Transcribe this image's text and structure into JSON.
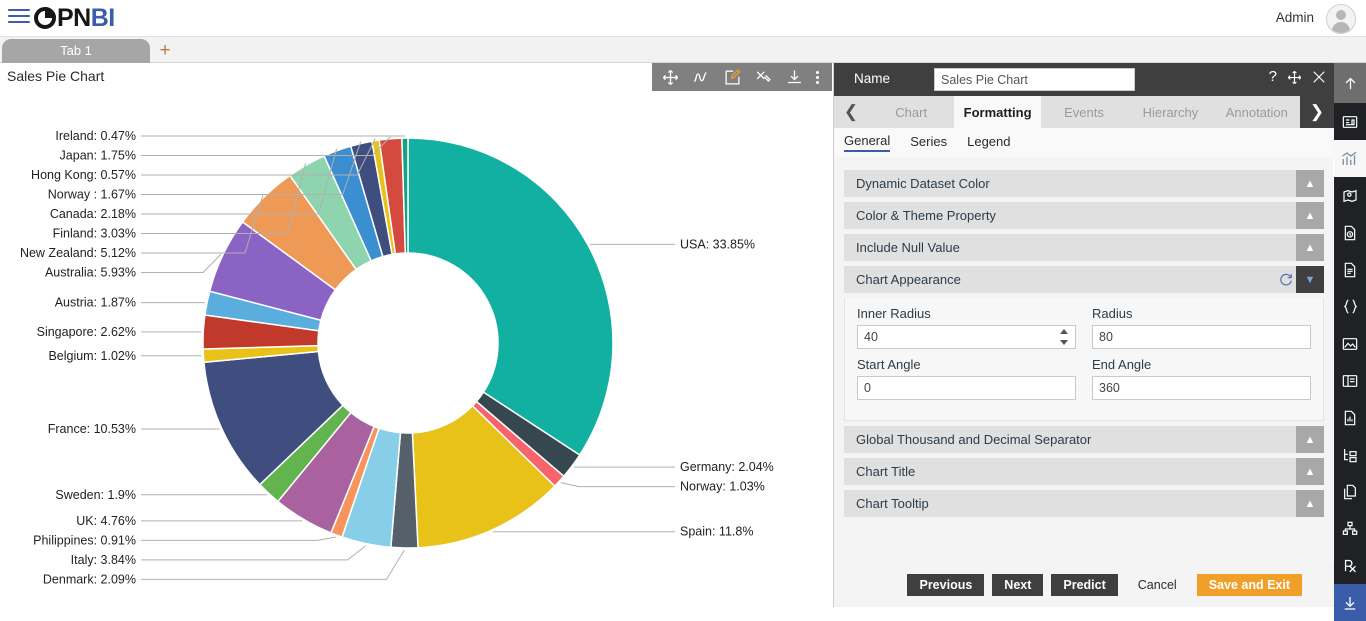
{
  "app": {
    "logo_dark": "PN",
    "logo_blue": "BI",
    "menu_icon": "hamburger-icon",
    "user_name": "Admin"
  },
  "tabstrip": {
    "tabs": [
      {
        "label": "Tab 1"
      }
    ],
    "add_label": "+",
    "icons": [
      "save-icon",
      "help-icon",
      "mail-icon",
      "comment-icon",
      "clear-filter-icon",
      "filter-icon",
      "tools-icon",
      "table-icon",
      "code-icon",
      "device-icon",
      "run-icon"
    ]
  },
  "chart_panel": {
    "title": "Sales Pie Chart",
    "tools": [
      "move-icon",
      "scribble-icon",
      "edit-icon",
      "settings-tools-icon",
      "download-icon",
      "more-options-icon"
    ]
  },
  "config": {
    "name_label": "Name",
    "name_value": "Sales Pie Chart",
    "name_placeholder": "Name",
    "header_icons": [
      "help-icon",
      "move-icon",
      "close-icon"
    ],
    "prev_arrow": "chevron-left-icon",
    "next_arrow": "chevron-right-icon",
    "tabs": [
      {
        "label": "Chart",
        "active": false
      },
      {
        "label": "Formatting",
        "active": true
      },
      {
        "label": "Events",
        "active": false
      },
      {
        "label": "Hierarchy",
        "active": false
      },
      {
        "label": "Annotation",
        "active": false
      }
    ],
    "subtabs": [
      {
        "label": "General",
        "active": true
      },
      {
        "label": "Series",
        "active": false
      },
      {
        "label": "Legend",
        "active": false
      }
    ],
    "sections_top": [
      {
        "title": "Dynamic Dataset Color",
        "open": false
      },
      {
        "title": "Color & Theme Property",
        "open": false
      },
      {
        "title": "Include Null Value",
        "open": false
      }
    ],
    "appearance": {
      "title": "Chart Appearance",
      "open": true,
      "refresh_icon": "refresh-icon",
      "fields": {
        "inner_radius_label": "Inner Radius",
        "inner_radius_value": "40",
        "radius_label": "Radius",
        "radius_value": "80",
        "start_angle_label": "Start Angle",
        "start_angle_value": "0",
        "end_angle_label": "End Angle",
        "end_angle_value": "360"
      }
    },
    "sections_bottom": [
      {
        "title": "Global Thousand and Decimal Separator",
        "open": false
      },
      {
        "title": "Chart Title",
        "open": false
      },
      {
        "title": "Chart Tooltip",
        "open": false
      }
    ],
    "buttons": {
      "previous": "Previous",
      "next": "Next",
      "predict": "Predict",
      "cancel": "Cancel",
      "save_exit": "Save and Exit"
    }
  },
  "rail": {
    "items": [
      "collapse-up-icon",
      "dashboard-icon",
      "chart-icon",
      "map-icon",
      "data-clock-icon",
      "document-icon",
      "braces-icon",
      "image-icon",
      "panel-icon",
      "report-icon",
      "tree-icon",
      "copy-icon",
      "org-chart-icon",
      "prescription-icon",
      "download-icon"
    ]
  },
  "colors": {
    "accent_blue": "#3b5ca8",
    "orange": "#f0a028",
    "dark_panel": "#3f3f3f",
    "rail_dark": "#1f2125"
  },
  "chart_data": {
    "type": "pie",
    "title": "Sales Pie Chart",
    "variant": "donut",
    "inner_radius": 40,
    "radius": 80,
    "start_angle": 0,
    "end_angle": 360,
    "legend": "none",
    "label_format": "{name}: {percent}%",
    "labels": [
      "USA",
      "Germany",
      "Norway",
      "Spain",
      "Denmark",
      "Italy",
      "Philippines",
      "UK",
      "Sweden",
      "France",
      "Belgium",
      "Singapore",
      "Austria",
      "Australia",
      "New Zealand",
      "Finland",
      "Canada",
      "Norway ",
      "Hong Kong",
      "Japan",
      "Ireland"
    ],
    "values": [
      33.85,
      2.04,
      1.03,
      11.8,
      2.09,
      3.84,
      0.91,
      4.76,
      1.9,
      10.53,
      1.02,
      2.62,
      1.87,
      5.93,
      5.12,
      3.03,
      2.18,
      1.67,
      0.57,
      1.75,
      0.47
    ],
    "label_texts": [
      "USA: 33.85%",
      "Germany: 2.04%",
      "Norway: 1.03%",
      "Spain: 11.8%",
      "Denmark: 2.09%",
      "Italy: 3.84%",
      "Philippines: 0.91%",
      "UK: 4.76%",
      "Sweden: 1.9%",
      "France: 10.53%",
      "Belgium: 1.02%",
      "Singapore: 2.62%",
      "Austria: 1.87%",
      "Australia: 5.93%",
      "New Zealand: 5.12%",
      "Finland: 3.03%",
      "Canada: 2.18%",
      "Norway : 1.67%",
      "Hong Kong: 0.57%",
      "Japan: 1.75%",
      "Ireland: 0.47%"
    ],
    "slice_colors": [
      "#12b0a0",
      "#37474f",
      "#f9636b",
      "#e8c218",
      "#55606a",
      "#87cfe8",
      "#f7945e",
      "#a9629f",
      "#62b54e",
      "#3f4e7f",
      "#e8c218",
      "#c0392b",
      "#5aaedd",
      "#8a63c4",
      "#ee9a56",
      "#8ed4ae",
      "#3b8ed0",
      "#3f4e7f",
      "#e8c218",
      "#d44a3f",
      "#16a085"
    ],
    "unit": "percent"
  }
}
